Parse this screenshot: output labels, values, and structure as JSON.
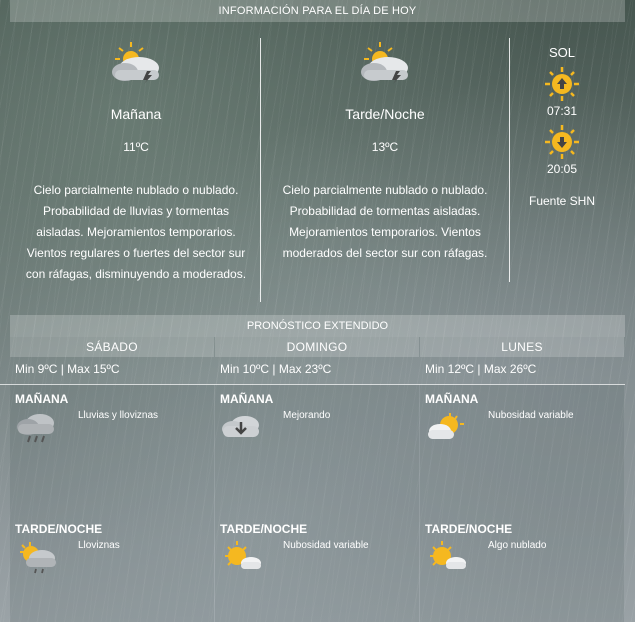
{
  "today": {
    "header": "INFORMACIÓN PARA EL DÍA DE HOY",
    "morning": {
      "title": "Mañana",
      "temp": "11ºC",
      "icon": "partly-cloudy-storm-icon",
      "desc": "Cielo parcialmente nublado o nublado. Probabilidad de lluvias y tormentas aisladas. Mejoramientos temporarios. Vientos regulares o fuertes del sector sur con ráfagas, disminuyendo a moderados."
    },
    "evening": {
      "title": "Tarde/Noche",
      "temp": "13ºC",
      "icon": "partly-cloudy-storm-icon",
      "desc": "Cielo parcialmente nublado o nublado. Probabilidad de tormentas aisladas. Mejoramientos temporarios. Vientos moderados del sector sur con ráfagas."
    },
    "sun": {
      "label": "SOL",
      "sunrise": "07:31",
      "sunset": "20:05",
      "source": "Fuente SHN"
    }
  },
  "extended": {
    "header": "PRONÓSTICO EXTENDIDO",
    "days": [
      {
        "name": "SÁBADO",
        "minmax": "Min 9ºC | Max 15ºC",
        "morning": {
          "label": "MAÑANA",
          "desc": "Lluvias y lloviznas",
          "icon": "rain-cloud-icon"
        },
        "evening": {
          "label": "TARDE/NOCHE",
          "desc": "Lloviznas",
          "icon": "sun-cloud-drizzle-icon"
        }
      },
      {
        "name": "DOMINGO",
        "minmax": "Min 10ºC | Max 23ºC",
        "morning": {
          "label": "MAÑANA",
          "desc": "Mejorando",
          "icon": "cloud-down-arrow-icon"
        },
        "evening": {
          "label": "TARDE/NOCHE",
          "desc": "Nubosidad variable",
          "icon": "sun-cloud-icon"
        }
      },
      {
        "name": "LUNES",
        "minmax": "Min 12ºC | Max 26ºC",
        "morning": {
          "label": "MAÑANA",
          "desc": "Nubosidad variable",
          "icon": "cloud-sun-icon"
        },
        "evening": {
          "label": "TARDE/NOCHE",
          "desc": "Algo nublado",
          "icon": "sun-cloud-icon"
        }
      }
    ]
  },
  "colors": {
    "sun": "#f5b820",
    "cloud": "#d9dde0"
  }
}
